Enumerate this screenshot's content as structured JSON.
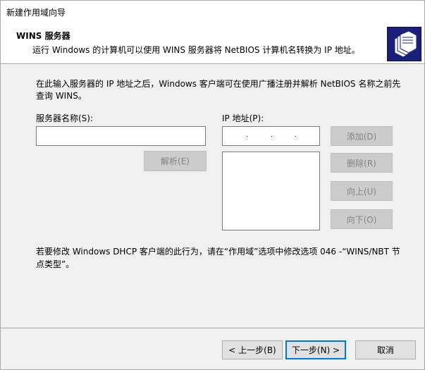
{
  "window": {
    "title": "新建作用域向导"
  },
  "header": {
    "title": "WINS 服务器",
    "subtitle": "运行 Windows 的计算机可以使用 WINS 服务器将 NetBIOS 计算机名转换为 IP 地址。",
    "icon": "folders-icon"
  },
  "description": "在此输入服务器的 IP 地址之后，Windows 客户端可在使用广播注册并解析 NetBIOS 名称之前先查询 WINS。",
  "server_name": {
    "label": "服务器名称(S):",
    "value": ""
  },
  "ip_address": {
    "label": "IP 地址(P):",
    "value": "",
    "separators": [
      ".",
      ".",
      "."
    ]
  },
  "buttons": {
    "resolve": "解析(E)",
    "add": "添加(D)",
    "remove": "删除(R)",
    "up": "向上(U)",
    "down": "向下(O)"
  },
  "ip_list": [],
  "note": "若要修改 Windows DHCP 客户端的此行为，请在“作用域”选项中修改选项 046 -“WINS/NBT 节点类型”。",
  "footer": {
    "back": "< 上一步(B)",
    "next": "下一步(N) >",
    "cancel": "取消"
  },
  "colors": {
    "icon_bg": "#1a1f7a",
    "default_button_border": "#0078d7"
  }
}
